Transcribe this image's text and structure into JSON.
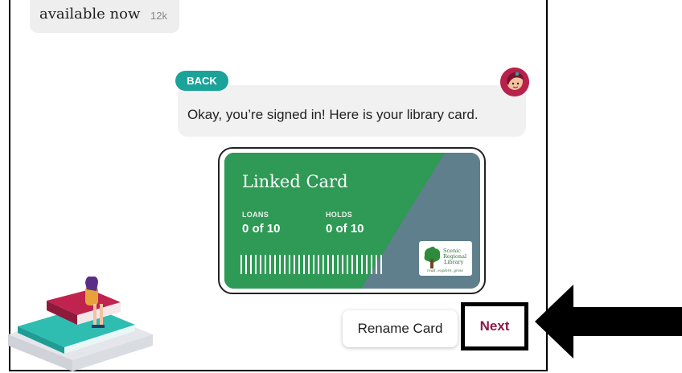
{
  "top_bubble": {
    "text": "available now",
    "count": "12k"
  },
  "back_label": "BACK",
  "message": "Okay, you’re signed in! Here is your library card.",
  "card": {
    "title": "Linked Card",
    "loans_label": "LOANS",
    "loans_value": "0 of 10",
    "holds_label": "HOLDS",
    "holds_value": "0 of 10",
    "logo_text": [
      "Scenic",
      "Regional",
      "Library"
    ],
    "logo_tagline": "read, explore, grow",
    "colors": {
      "green": "#2e9a55",
      "slate": "#5f7f8c"
    }
  },
  "buttons": {
    "rename": "Rename Card",
    "next": "Next"
  },
  "colors": {
    "teal": "#1ba39a",
    "next_text": "#8a1a48",
    "avatar": "#b8214b"
  }
}
